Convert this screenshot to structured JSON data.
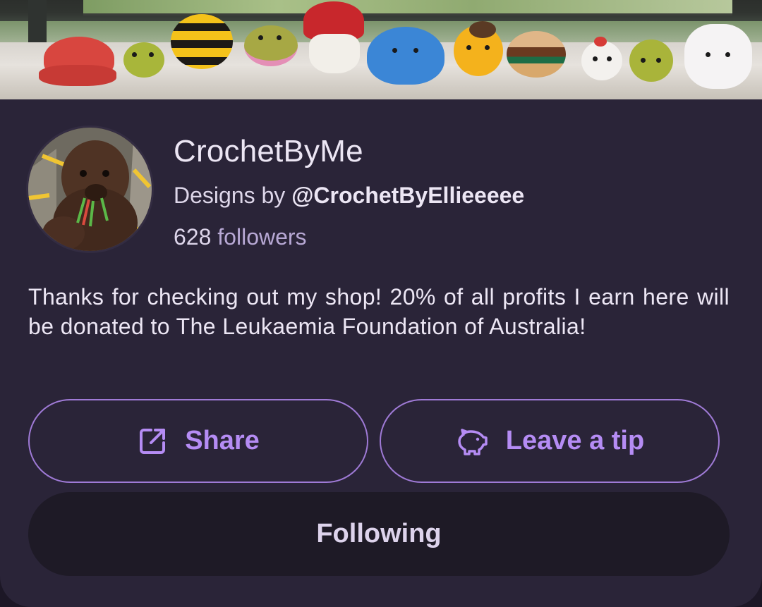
{
  "profile": {
    "name": "CrochetByMe",
    "subtitle_prefix": "Designs by",
    "handle": "@CrochetByEllieeeee",
    "followers_count": "628",
    "followers_label": "followers",
    "bio": "Thanks for checking out my shop! 20% of all profits I earn here will be donated to The Leukaemia Foundation of Australia!"
  },
  "actions": {
    "share_label": "Share",
    "share_icon": "external-link-icon",
    "tip_label": "Leave a tip",
    "tip_icon": "piggy-bank-icon",
    "following_label": "Following"
  },
  "colors": {
    "accent": "#b58cf4",
    "card_background": "#2a2438",
    "following_button_background": "#1e1a26"
  }
}
